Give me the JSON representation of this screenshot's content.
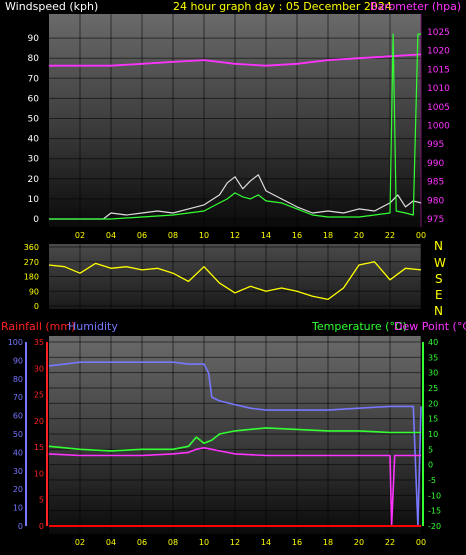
{
  "header": {
    "left_label": "Windspeed (kph)",
    "center_label": "24 hour graph day : 05 December 2024",
    "right_label": "Barometer (hpa)"
  },
  "time_ticks": [
    "02",
    "04",
    "06",
    "08",
    "10",
    "12",
    "14",
    "16",
    "18",
    "20",
    "22",
    "00"
  ],
  "direction_letters": [
    "N",
    "W",
    "S",
    "E",
    "N"
  ],
  "lower_labels": {
    "rainfall": "Rainfall (mm)",
    "humidity": "Humidity",
    "temperature": "Temperature (°C)",
    "dewpoint": "Dew Point (°C)"
  },
  "colors": {
    "wind_gust": "#dddddd",
    "wind_avg": "#33ff33",
    "barometer": "#ff33ff",
    "direction": "#ffff00",
    "humidity": "#7777ff",
    "temperature": "#33ff33",
    "dewpoint": "#ff33ff",
    "rainfall": "#ff0000",
    "background_top": "#5a5a5a",
    "background_bottom": "#0a0a0a"
  },
  "chart_data": [
    {
      "type": "line",
      "title": "24 hour graph day : 05 December 2024",
      "x_range_hours": [
        0,
        24
      ],
      "y_left": {
        "label": "Windspeed (kph)",
        "ticks": [
          0,
          10,
          20,
          30,
          40,
          50,
          60,
          70,
          80,
          90
        ],
        "range": [
          0,
          100
        ]
      },
      "y_right": {
        "label": "Barometer (hpa)",
        "ticks": [
          975,
          980,
          985,
          990,
          995,
          1000,
          1005,
          1010,
          1015,
          1020,
          1025
        ],
        "range": [
          973,
          1028
        ]
      },
      "series": [
        {
          "name": "Barometer (hpa)",
          "axis": "right",
          "x": [
            0,
            2,
            4,
            6,
            8,
            10,
            12,
            14,
            16,
            18,
            20,
            22,
            24
          ],
          "values": [
            1016,
            1016,
            1016,
            1016.5,
            1017,
            1017.5,
            1016.5,
            1016,
            1016.5,
            1017.5,
            1018,
            1018.5,
            1019
          ]
        },
        {
          "axis": "left",
          "x": [
            0,
            3.5,
            4,
            5,
            6,
            7,
            8,
            9,
            10,
            11,
            11.5,
            12,
            12.5,
            13,
            13.5,
            14,
            15,
            16,
            17,
            18,
            19,
            20,
            21,
            22,
            22.5,
            23,
            23.5,
            24
          ],
          "values": [
            0,
            0,
            3,
            2,
            3,
            4,
            3,
            5,
            7,
            12,
            18,
            21,
            15,
            19,
            22,
            14,
            10,
            6,
            3,
            4,
            3,
            5,
            4,
            8,
            12,
            6,
            9,
            8
          ]
        },
        {
          "axis": "left",
          "x": [
            0,
            4,
            6,
            8,
            10,
            10.5,
            11,
            11.5,
            12,
            12.5,
            13,
            13.5,
            14,
            15,
            16,
            17,
            18,
            20,
            21,
            22,
            22.2,
            22.4,
            23,
            23.5,
            23.8,
            24
          ],
          "values": [
            0,
            0,
            1,
            2,
            4,
            6,
            8,
            10,
            13,
            11,
            10,
            12,
            9,
            8,
            5,
            2,
            1,
            1,
            2,
            3,
            92,
            4,
            3,
            2,
            92,
            92
          ]
        }
      ]
    },
    {
      "type": "line",
      "y_left": {
        "ticks": [
          0,
          90,
          180,
          270,
          360
        ],
        "range": [
          0,
          360
        ]
      },
      "x_range_hours": [
        0,
        24
      ],
      "series": [
        {
          "axis": "left",
          "x": [
            0,
            1,
            2,
            3,
            4,
            5,
            6,
            7,
            8,
            9,
            10,
            11,
            12,
            13,
            14,
            15,
            16,
            17,
            18,
            19,
            20,
            21,
            22,
            23,
            24
          ],
          "values": [
            250,
            240,
            200,
            260,
            230,
            240,
            220,
            230,
            200,
            150,
            240,
            140,
            80,
            120,
            90,
            110,
            90,
            60,
            40,
            110,
            250,
            270,
            160,
            230,
            220
          ]
        }
      ]
    },
    {
      "type": "line",
      "x_range_hours": [
        0,
        24
      ],
      "y_rain": {
        "label": "Rainfall (mm)",
        "ticks": [
          0,
          5,
          10,
          15,
          20,
          25,
          30,
          35
        ],
        "range": [
          0,
          35
        ]
      },
      "y_humidity": {
        "label": "Humidity",
        "ticks": [
          0,
          10,
          20,
          30,
          40,
          50,
          60,
          70,
          80,
          90,
          100
        ],
        "range": [
          0,
          100
        ]
      },
      "y_temp": {
        "label": "Temperature (°C)",
        "ticks": [
          -20,
          -15,
          -10,
          -5,
          0,
          5,
          10,
          15,
          20,
          25,
          30,
          35,
          40
        ],
        "range": [
          -20,
          40
        ]
      },
      "series": [
        {
          "name": "Humidity",
          "axis": "humidity",
          "x": [
            0,
            1,
            2,
            4,
            6,
            8,
            9,
            10,
            10.3,
            10.5,
            11,
            12,
            13,
            14,
            16,
            18,
            20,
            22,
            23,
            23.5,
            23.8,
            24
          ],
          "values": [
            87,
            88,
            89,
            89,
            89,
            89,
            88,
            88,
            83,
            70,
            68,
            66,
            64,
            63,
            63,
            63,
            64,
            65,
            65,
            65,
            0,
            65
          ]
        },
        {
          "name": "Temperature (°C)",
          "axis": "temp",
          "x": [
            0,
            2,
            4,
            6,
            8,
            9,
            9.5,
            10,
            10.5,
            11,
            12,
            14,
            16,
            18,
            20,
            22,
            24
          ],
          "values": [
            6,
            5,
            4.5,
            5,
            5,
            6,
            9,
            7,
            8,
            10,
            11,
            12,
            11.5,
            11,
            11,
            10.5,
            10.5
          ]
        },
        {
          "name": "Dew Point (°C)",
          "axis": "temp",
          "x": [
            0,
            2,
            4,
            6,
            8,
            9,
            9.5,
            10,
            10.5,
            11,
            12,
            14,
            16,
            18,
            20,
            21.5,
            22,
            22.1,
            22.3,
            24
          ],
          "values": [
            3.5,
            3,
            3,
            3,
            3.5,
            4,
            5,
            5.5,
            5,
            4.5,
            3.5,
            3,
            3,
            3,
            3,
            3,
            3,
            -20,
            3,
            3
          ]
        },
        {
          "name": "Rainfall (mm)",
          "axis": "rain",
          "x": [
            0,
            24
          ],
          "values": [
            0,
            0
          ]
        }
      ]
    }
  ]
}
